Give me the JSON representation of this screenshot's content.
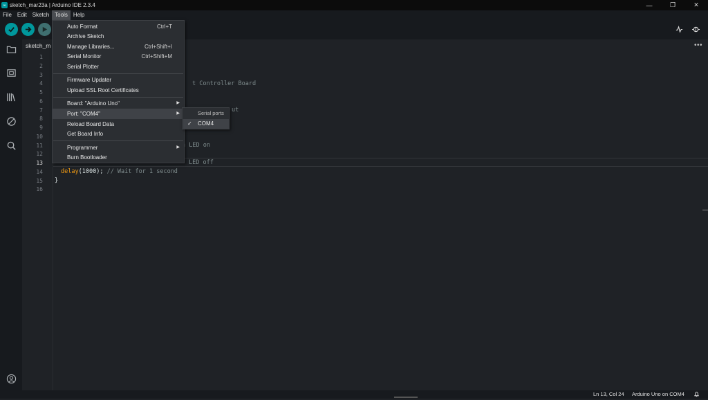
{
  "window": {
    "title": "sketch_mar23a | Arduino IDE 2.3.4",
    "app_icon": "arduino-icon",
    "controls": [
      "minimize-icon",
      "restore-icon",
      "close-icon"
    ]
  },
  "menubar": {
    "items": [
      "File",
      "Edit",
      "Sketch",
      "Tools",
      "Help"
    ],
    "active": "Tools"
  },
  "toolbar": {
    "verify_icon": "check-icon",
    "upload_icon": "arrow-right-icon",
    "debug_icon": "debug-icon",
    "serial_plotter_icon": "plotter-icon",
    "serial_monitor_icon": "serial-monitor-icon",
    "accent_color": "#00979c"
  },
  "editor_tab": {
    "label": "sketch_m",
    "more_label": "•••"
  },
  "sidebar": {
    "icons": [
      "folder-icon",
      "board-manager-icon",
      "library-icon",
      "debug-disabled-icon",
      "search-icon",
      "account-icon"
    ]
  },
  "editor": {
    "line_numbers": [
      "1",
      "2",
      "3",
      "4",
      "5",
      "6",
      "7",
      "8",
      "9",
      "10",
      "11",
      "12",
      "13",
      "14",
      "15",
      "16"
    ],
    "current_line": "13",
    "visible_fragments": {
      "line4": "t Controller Board",
      "line6": "ut",
      "line11": "n LED on",
      "line13": "LED off",
      "line14_kw": "delay",
      "line14_open": "(",
      "line14_num": "1000",
      "line14_close": ");",
      "line14_comment": "// Wait for 1 second",
      "line15": "}"
    }
  },
  "tools_menu": {
    "items": [
      {
        "label": "Auto Format",
        "shortcut": "Ctrl+T"
      },
      {
        "label": "Archive Sketch",
        "shortcut": ""
      },
      {
        "label": "Manage Libraries...",
        "shortcut": "Ctrl+Shift+I"
      },
      {
        "label": "Serial Monitor",
        "shortcut": "Ctrl+Shift+M"
      },
      {
        "label": "Serial Plotter",
        "shortcut": ""
      },
      {
        "label": "Firmware Updater",
        "shortcut": ""
      },
      {
        "label": "Upload SSL Root Certificates",
        "shortcut": ""
      },
      {
        "label": "Board: \"Arduino Uno\"",
        "shortcut": ""
      },
      {
        "label": "Port: \"COM4\"",
        "shortcut": ""
      },
      {
        "label": "Reload Board Data",
        "shortcut": ""
      },
      {
        "label": "Get Board Info",
        "shortcut": ""
      },
      {
        "label": "Programmer",
        "shortcut": ""
      },
      {
        "label": "Burn Bootloader",
        "shortcut": ""
      }
    ],
    "highlighted": "Port: \"COM4\""
  },
  "port_submenu": {
    "header": "Serial ports",
    "selected": "COM4",
    "check": "✓"
  },
  "statusbar": {
    "position": "Ln 13, Col 24",
    "board": "Arduino Uno on COM4",
    "notification_icon": "bell-icon"
  }
}
